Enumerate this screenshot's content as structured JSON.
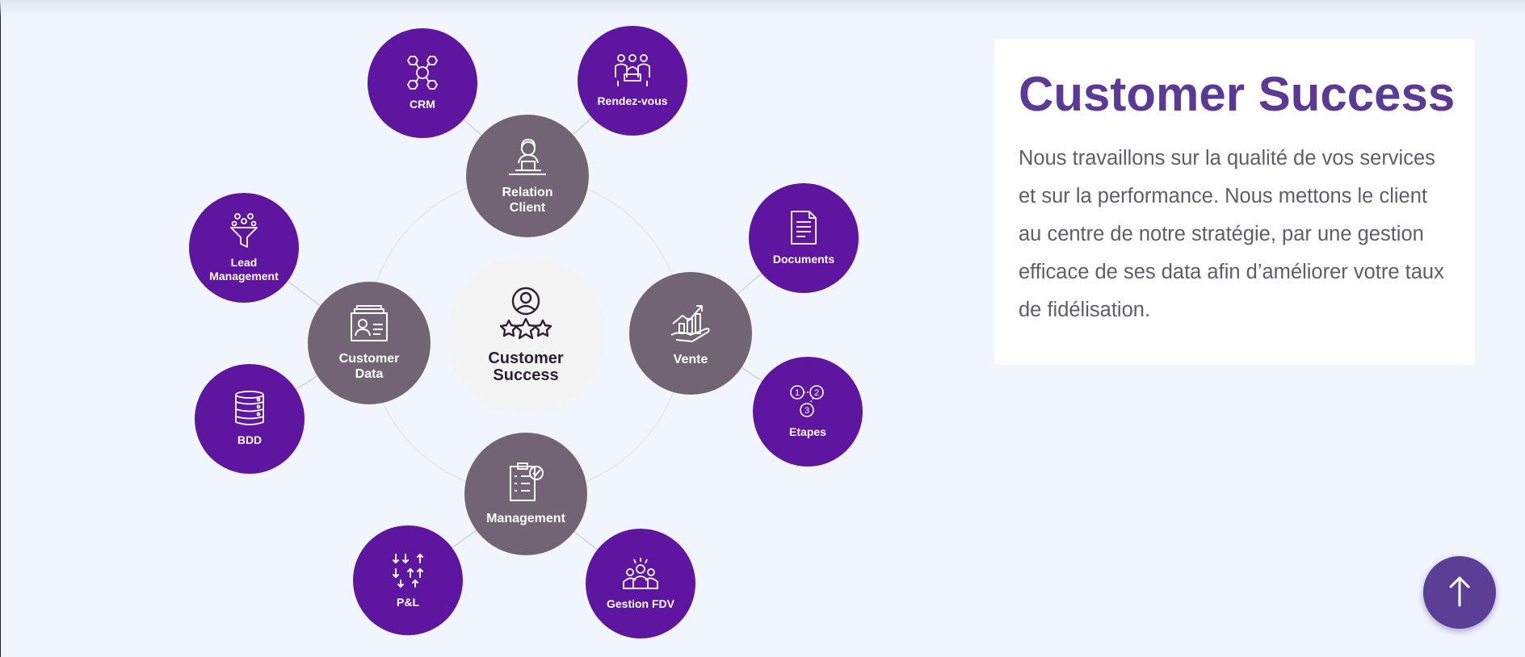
{
  "diagram": {
    "center": {
      "label_line1": "Customer",
      "label_line2": "Success",
      "icon": "customer-stars-icon"
    },
    "hubs": [
      {
        "id": "relation",
        "label_line1": "Relation",
        "label_line2": "Client",
        "icon": "support-agent-icon"
      },
      {
        "id": "data",
        "label_line1": "Customer",
        "label_line2": "Data",
        "icon": "profile-card-icon"
      },
      {
        "id": "vente",
        "label_line1": "Vente",
        "label_line2": "",
        "icon": "sales-growth-icon"
      },
      {
        "id": "management",
        "label_line1": "Management",
        "label_line2": "",
        "icon": "checklist-icon"
      }
    ],
    "satellites": [
      {
        "id": "crm",
        "label_line1": "CRM",
        "label_line2": "",
        "icon": "network-icon"
      },
      {
        "id": "rdv",
        "label_line1": "Rendez-vous",
        "label_line2": "",
        "icon": "meeting-icon"
      },
      {
        "id": "lead",
        "label_line1": "Lead",
        "label_line2": "Management",
        "icon": "funnel-icon"
      },
      {
        "id": "bdd",
        "label_line1": "BDD",
        "label_line2": "",
        "icon": "database-icon"
      },
      {
        "id": "documents",
        "label_line1": "Documents",
        "label_line2": "",
        "icon": "document-icon"
      },
      {
        "id": "etapes",
        "label_line1": "Etapes",
        "label_line2": "",
        "icon": "steps-icon"
      },
      {
        "id": "pl",
        "label_line1": "P&L",
        "label_line2": "",
        "icon": "arrows-up-down-icon"
      },
      {
        "id": "fdv",
        "label_line1": "Gestion FDV",
        "label_line2": "",
        "icon": "team-icon"
      }
    ]
  },
  "card": {
    "title": "Customer Success",
    "body": "Nous travaillons sur la qualité de vos services et sur la performance. Nous mettons le client au centre de notre stratégie, par une gestion efficace de ses data afin d’améliorer votre taux de fidélisation."
  },
  "scroll_top": {
    "icon": "arrow-up-icon"
  },
  "colors": {
    "satellite": "#5e16a0",
    "hub": "#726474",
    "center": "#f3f3f4",
    "title": "#5a3a96",
    "background": "#f1f5fe"
  }
}
